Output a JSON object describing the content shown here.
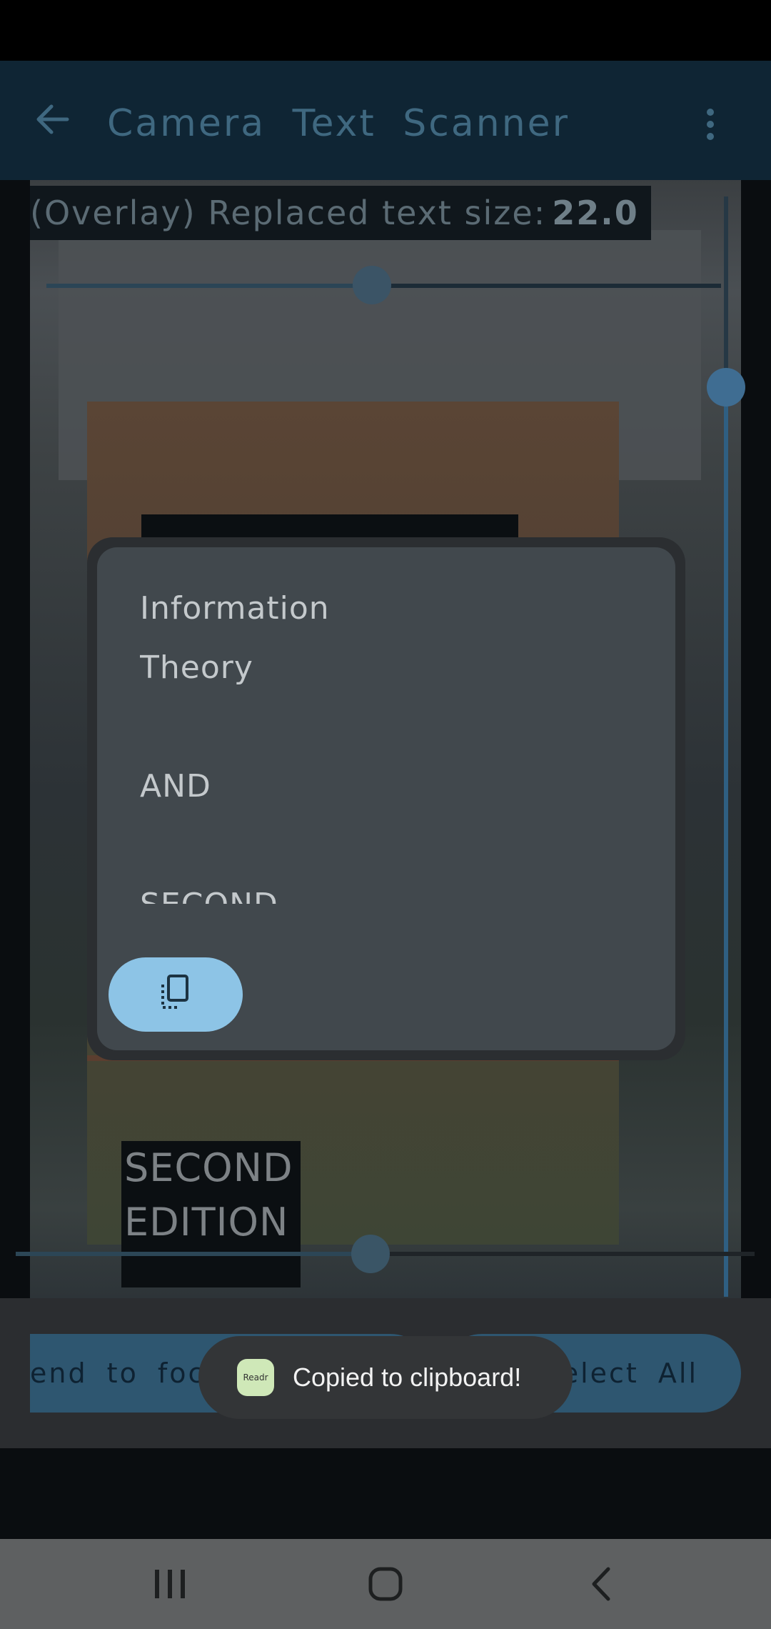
{
  "app": {
    "title": "Camera Text Scanner",
    "accent": "#3f6880"
  },
  "overlay": {
    "label": "(Overlay) Replaced text size:",
    "value": "22.0"
  },
  "dialog": {
    "lines": [
      "Information",
      "Theory",
      "",
      "AND",
      "",
      "SECOND"
    ]
  },
  "detected_text": {
    "lines": [
      "SECOND",
      "EDITION"
    ]
  },
  "actions": {
    "left_label": "end to focus",
    "right_label": "Select All"
  },
  "toast": {
    "app_icon_text": "Readr",
    "message": "Copied to clipboard!"
  }
}
